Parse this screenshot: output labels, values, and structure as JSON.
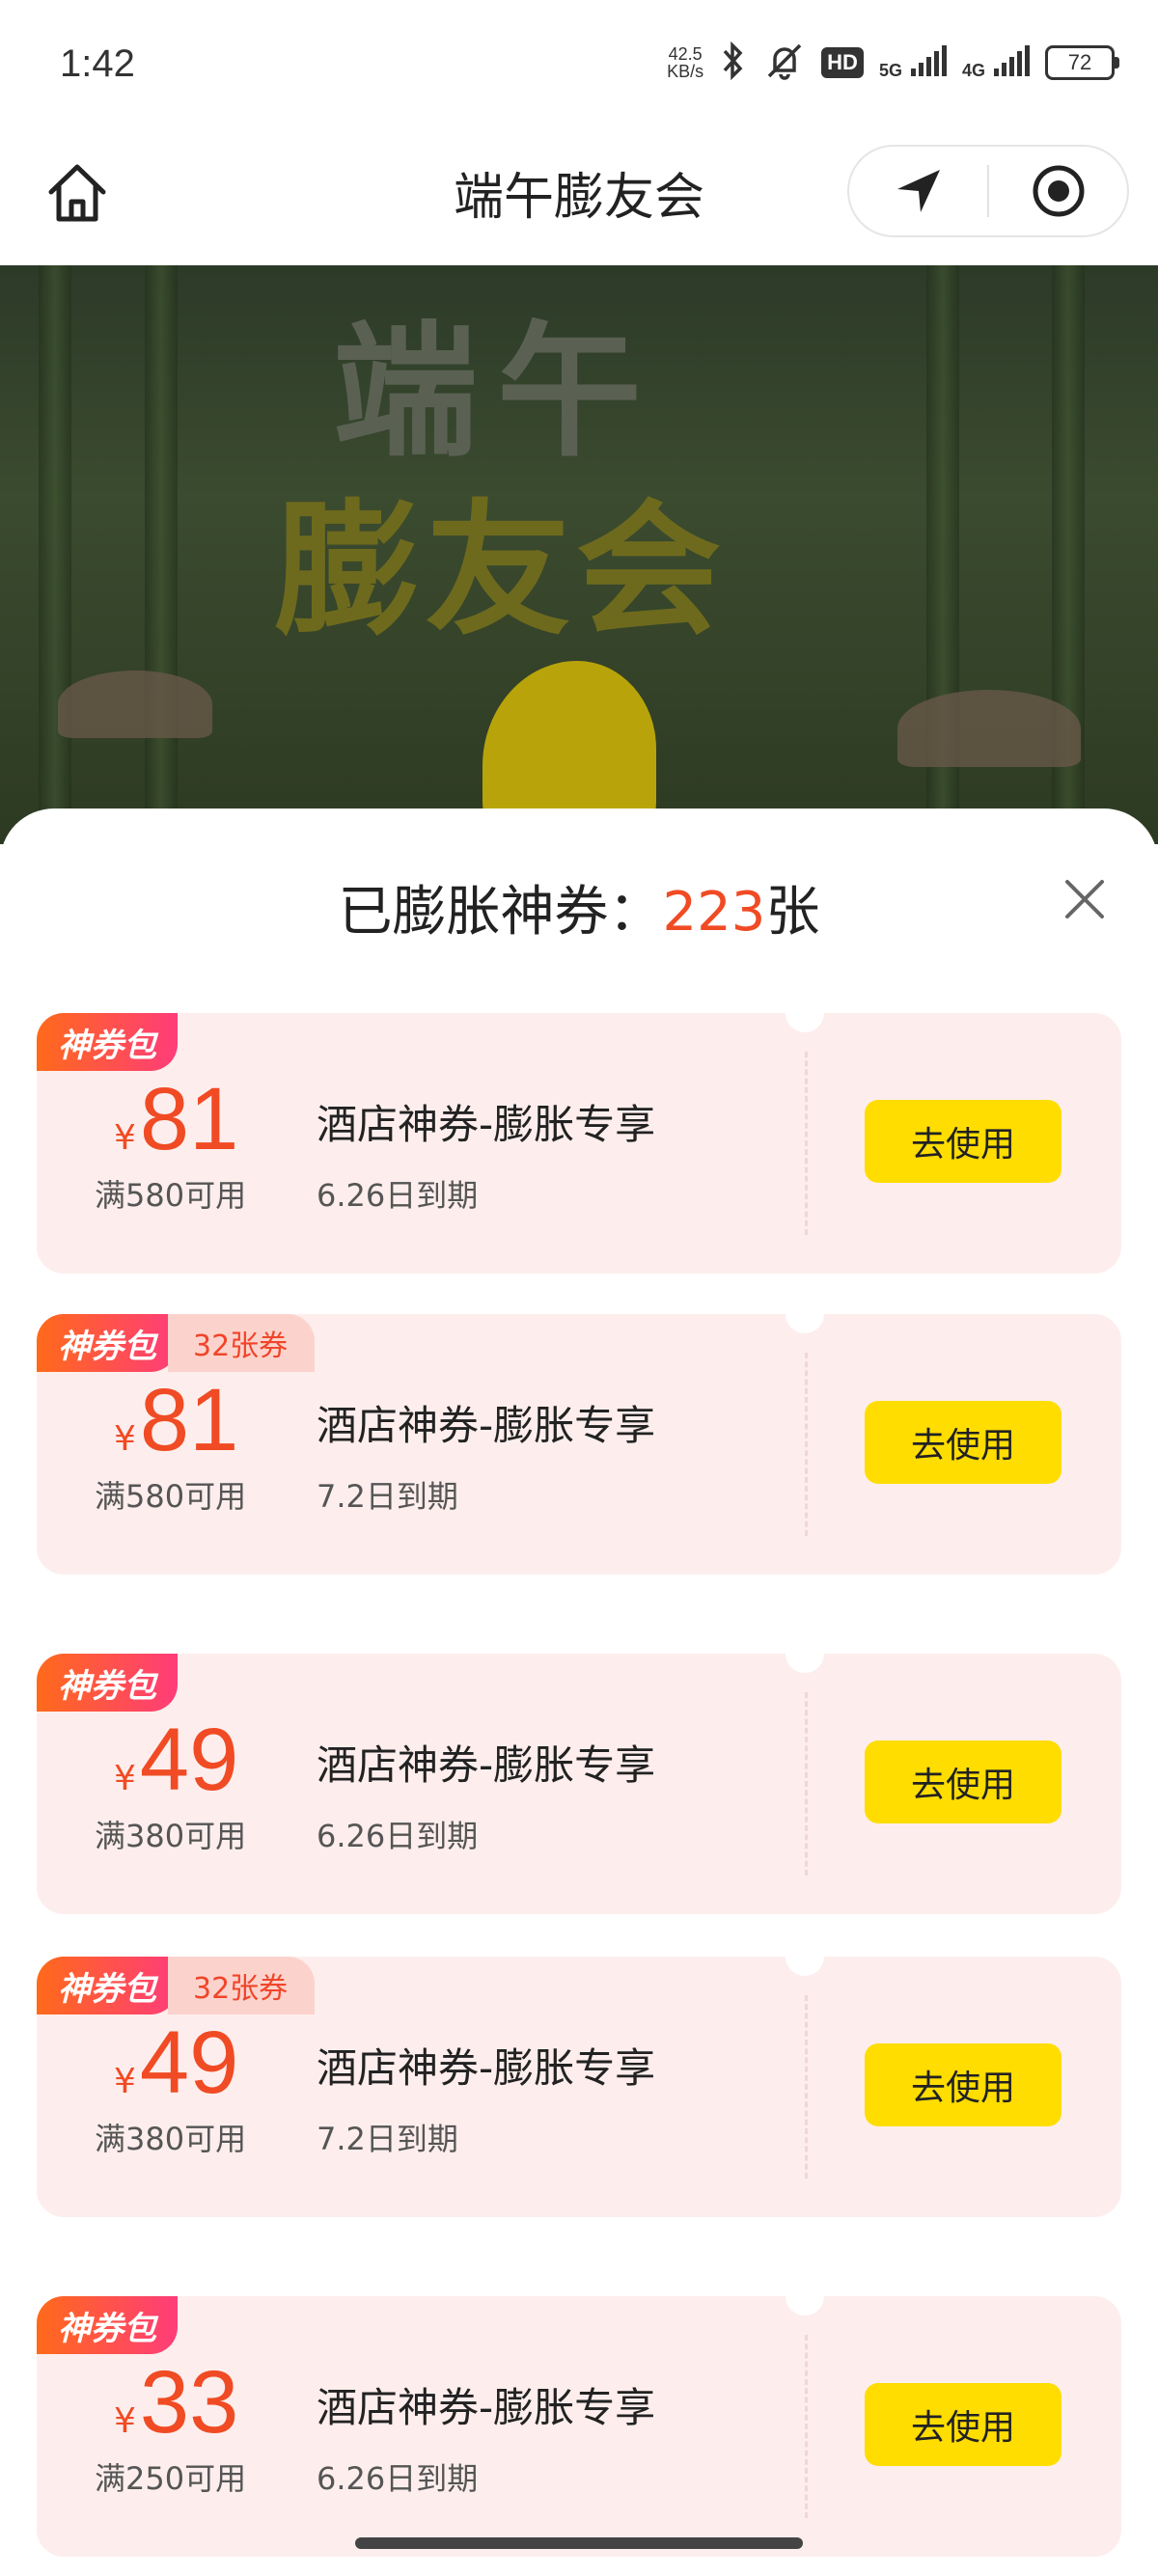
{
  "status_bar": {
    "time": "1:42",
    "net_speed_value": "42.5",
    "net_speed_unit": "KB/s",
    "hd_badge": "HD",
    "sim1": "5G",
    "sim2": "4G",
    "battery": "72"
  },
  "nav": {
    "title": "端午膨友会"
  },
  "banner": {
    "line1": "端午",
    "line2": "膨友会"
  },
  "sheet": {
    "title_prefix": "已膨胀神券：",
    "count": "223",
    "title_suffix": "张"
  },
  "coupons": [
    {
      "tag": "神券包",
      "count_tag": "",
      "currency": "¥",
      "amount": "81",
      "threshold": "满580可用",
      "name": "酒店神券-膨胀专享",
      "expiry": "6.26日到期",
      "button": "去使用"
    },
    {
      "tag": "神券包",
      "count_tag": "32张券",
      "currency": "¥",
      "amount": "81",
      "threshold": "满580可用",
      "name": "酒店神券-膨胀专享",
      "expiry": "7.2日到期",
      "button": "去使用"
    },
    {
      "tag": "神券包",
      "count_tag": "",
      "currency": "¥",
      "amount": "49",
      "threshold": "满380可用",
      "name": "酒店神券-膨胀专享",
      "expiry": "6.26日到期",
      "button": "去使用"
    },
    {
      "tag": "神券包",
      "count_tag": "32张券",
      "currency": "¥",
      "amount": "49",
      "threshold": "满380可用",
      "name": "酒店神券-膨胀专享",
      "expiry": "7.2日到期",
      "button": "去使用"
    },
    {
      "tag": "神券包",
      "count_tag": "",
      "currency": "¥",
      "amount": "33",
      "threshold": "满250可用",
      "name": "酒店神券-膨胀专享",
      "expiry": "6.26日到期",
      "button": "去使用"
    }
  ],
  "colors": {
    "accent_red": "#f04b24",
    "button_yellow": "#ffdd00",
    "card_bg": "#fdeeed"
  }
}
